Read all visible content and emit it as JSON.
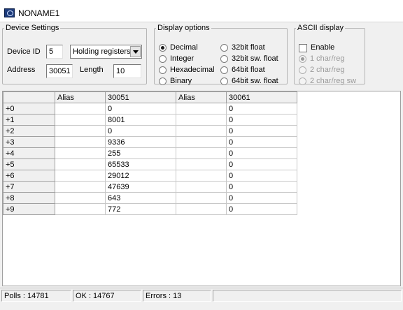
{
  "window": {
    "title": "NONAME1"
  },
  "device_settings": {
    "legend": "Device Settings",
    "device_id_label": "Device ID",
    "device_id_value": "5",
    "function_select": "Holding registers",
    "address_label": "Address",
    "address_value": "30051",
    "length_label": "Length",
    "length_value": "10"
  },
  "display_options": {
    "legend": "Display options",
    "options": [
      {
        "label": "Decimal",
        "selected": true
      },
      {
        "label": "Integer",
        "selected": false
      },
      {
        "label": "Hexadecimal",
        "selected": false
      },
      {
        "label": "Binary",
        "selected": false
      },
      {
        "label": "32bit float",
        "selected": false
      },
      {
        "label": "32bit sw. float",
        "selected": false
      },
      {
        "label": "64bit float",
        "selected": false
      },
      {
        "label": "64bit sw. float",
        "selected": false
      }
    ]
  },
  "ascii_display": {
    "legend": "ASCII display",
    "enable_label": "Enable",
    "enabled": false,
    "options": [
      {
        "label": "1 char/reg",
        "selected": true
      },
      {
        "label": "2 char/reg",
        "selected": false
      },
      {
        "label": "2 char/reg sw",
        "selected": false
      }
    ]
  },
  "table": {
    "headers": [
      "",
      "Alias",
      "30051",
      "Alias",
      "30061"
    ],
    "rows": [
      {
        "label": "+0",
        "alias1": "",
        "val1": "0",
        "alias2": "",
        "val2": "0"
      },
      {
        "label": "+1",
        "alias1": "",
        "val1": "8001",
        "alias2": "",
        "val2": "0"
      },
      {
        "label": "+2",
        "alias1": "",
        "val1": "0",
        "alias2": "",
        "val2": "0"
      },
      {
        "label": "+3",
        "alias1": "",
        "val1": "9336",
        "alias2": "",
        "val2": "0"
      },
      {
        "label": "+4",
        "alias1": "",
        "val1": "255",
        "alias2": "",
        "val2": "0"
      },
      {
        "label": "+5",
        "alias1": "",
        "val1": "65533",
        "alias2": "",
        "val2": "0"
      },
      {
        "label": "+6",
        "alias1": "",
        "val1": "29012",
        "alias2": "",
        "val2": "0"
      },
      {
        "label": "+7",
        "alias1": "",
        "val1": "47639",
        "alias2": "",
        "val2": "0"
      },
      {
        "label": "+8",
        "alias1": "",
        "val1": "643",
        "alias2": "",
        "val2": "0"
      },
      {
        "label": "+9",
        "alias1": "",
        "val1": "772",
        "alias2": "",
        "val2": "0"
      }
    ]
  },
  "status": {
    "polls": "Polls : 14781",
    "ok": "OK : 14767",
    "errors": "Errors : 13",
    "extra": ""
  }
}
